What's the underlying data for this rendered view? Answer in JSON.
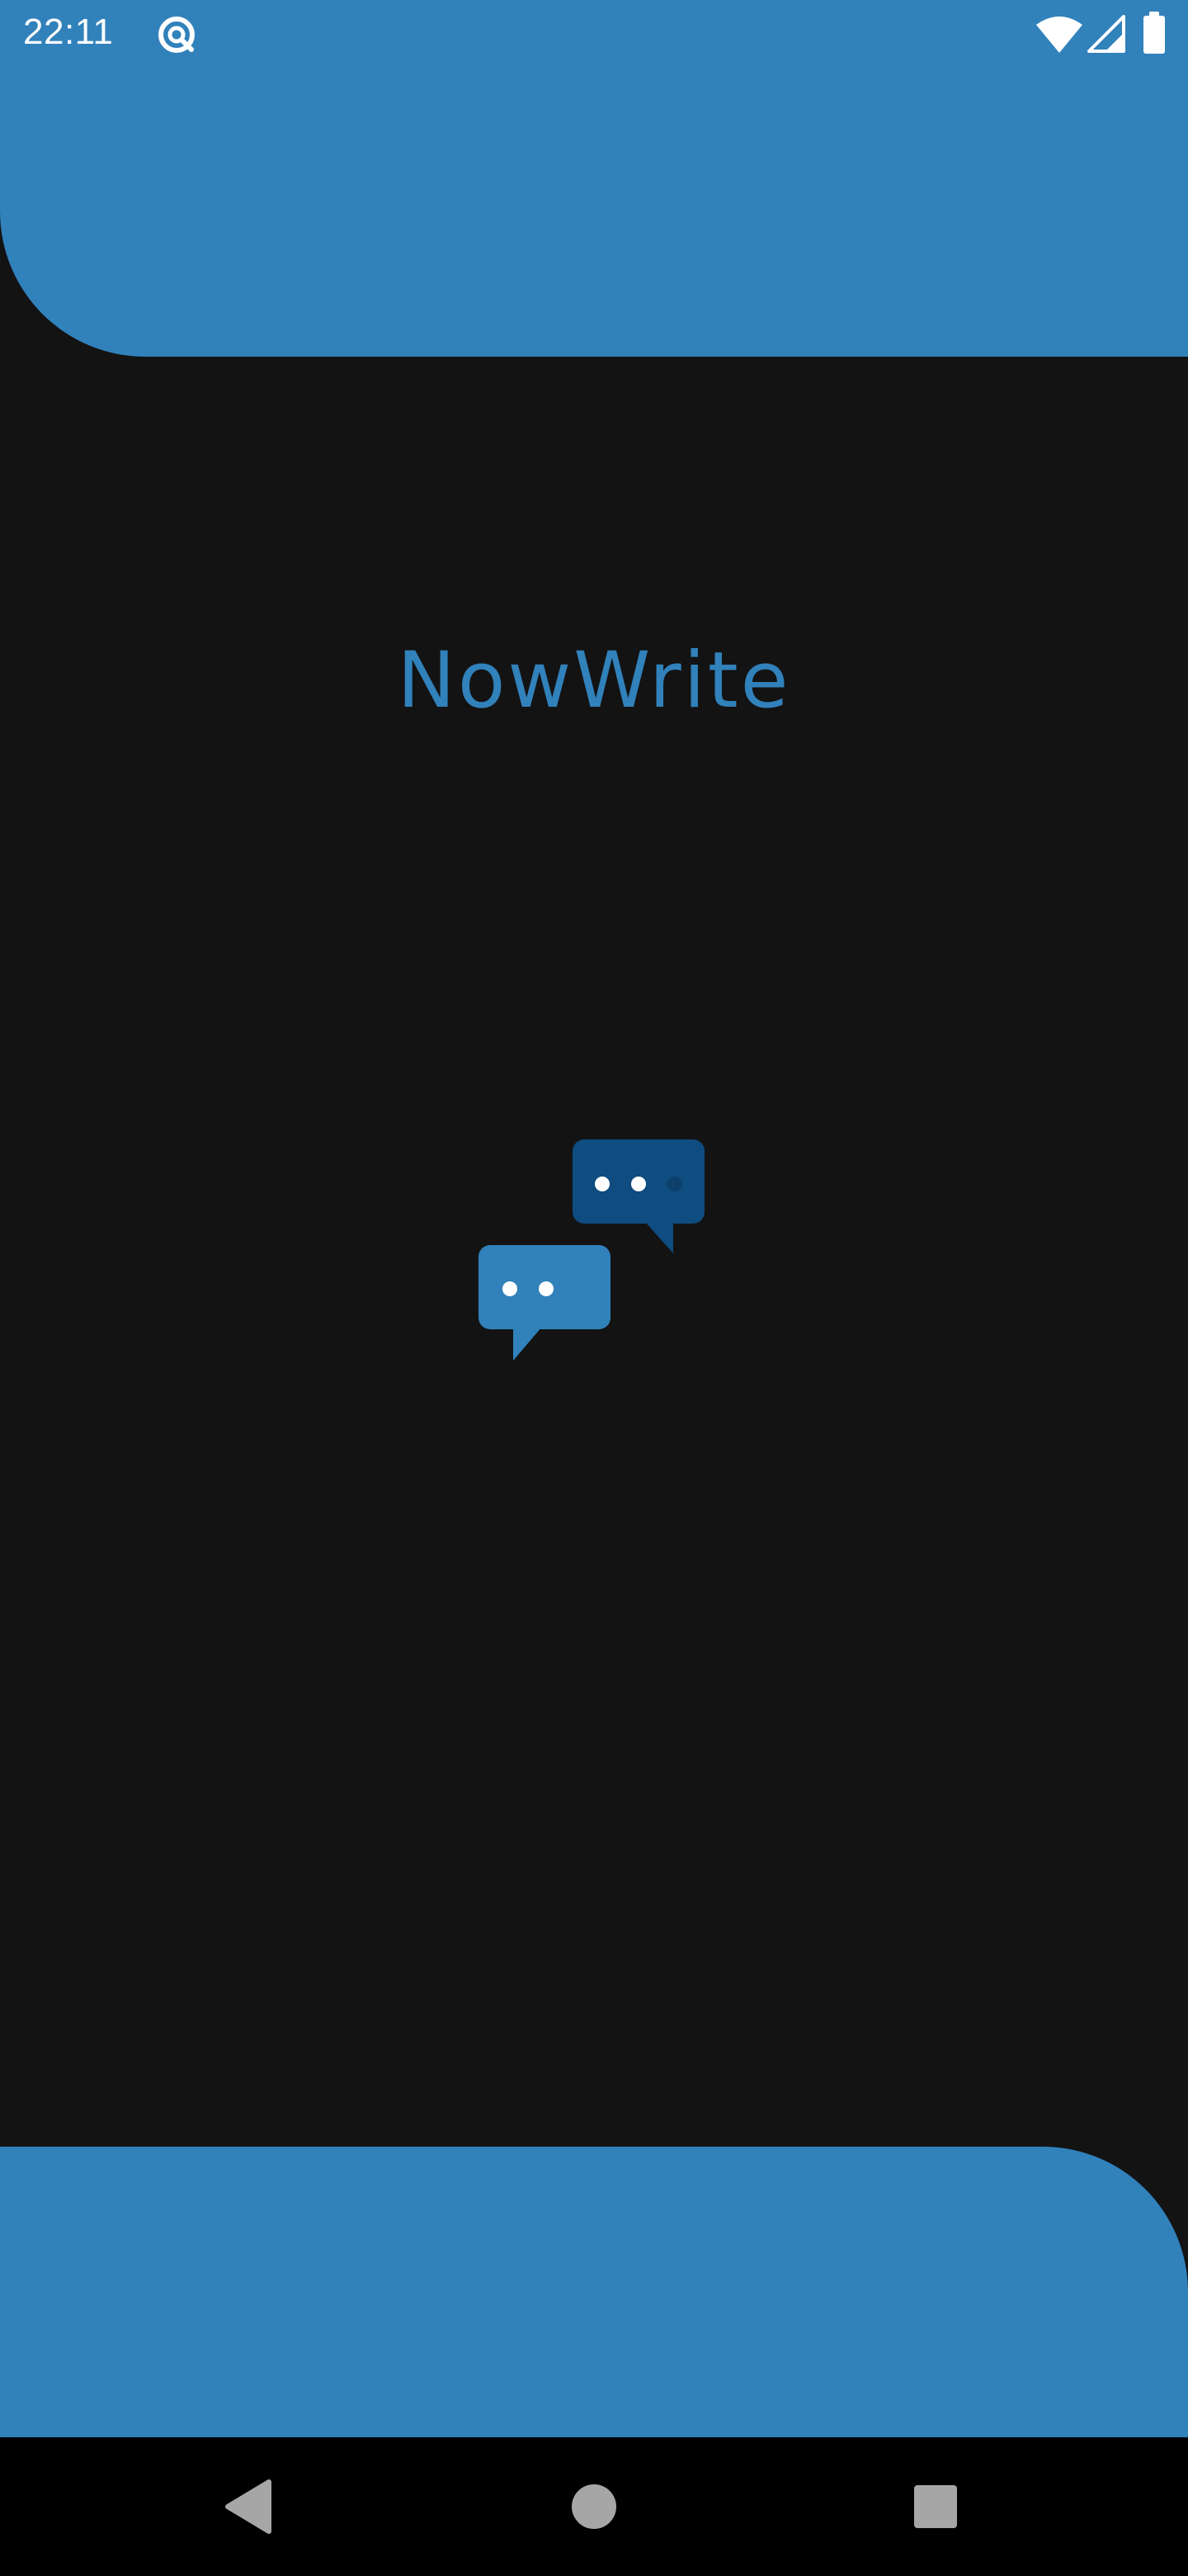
{
  "app": {
    "title": "NowWrite",
    "logo_icon": "chat-bubbles-icon"
  },
  "status_bar": {
    "time": "22:11",
    "icons": [
      "sync-icon",
      "wifi-icon",
      "signal-icon",
      "battery-icon"
    ]
  },
  "nav_bar": {
    "buttons": [
      "back-icon",
      "home-icon",
      "recents-icon"
    ]
  },
  "colors": {
    "accent": "#3181bb",
    "accent_dark": "#0f4c7f",
    "background": "#131313",
    "nav_background": "#000000"
  }
}
